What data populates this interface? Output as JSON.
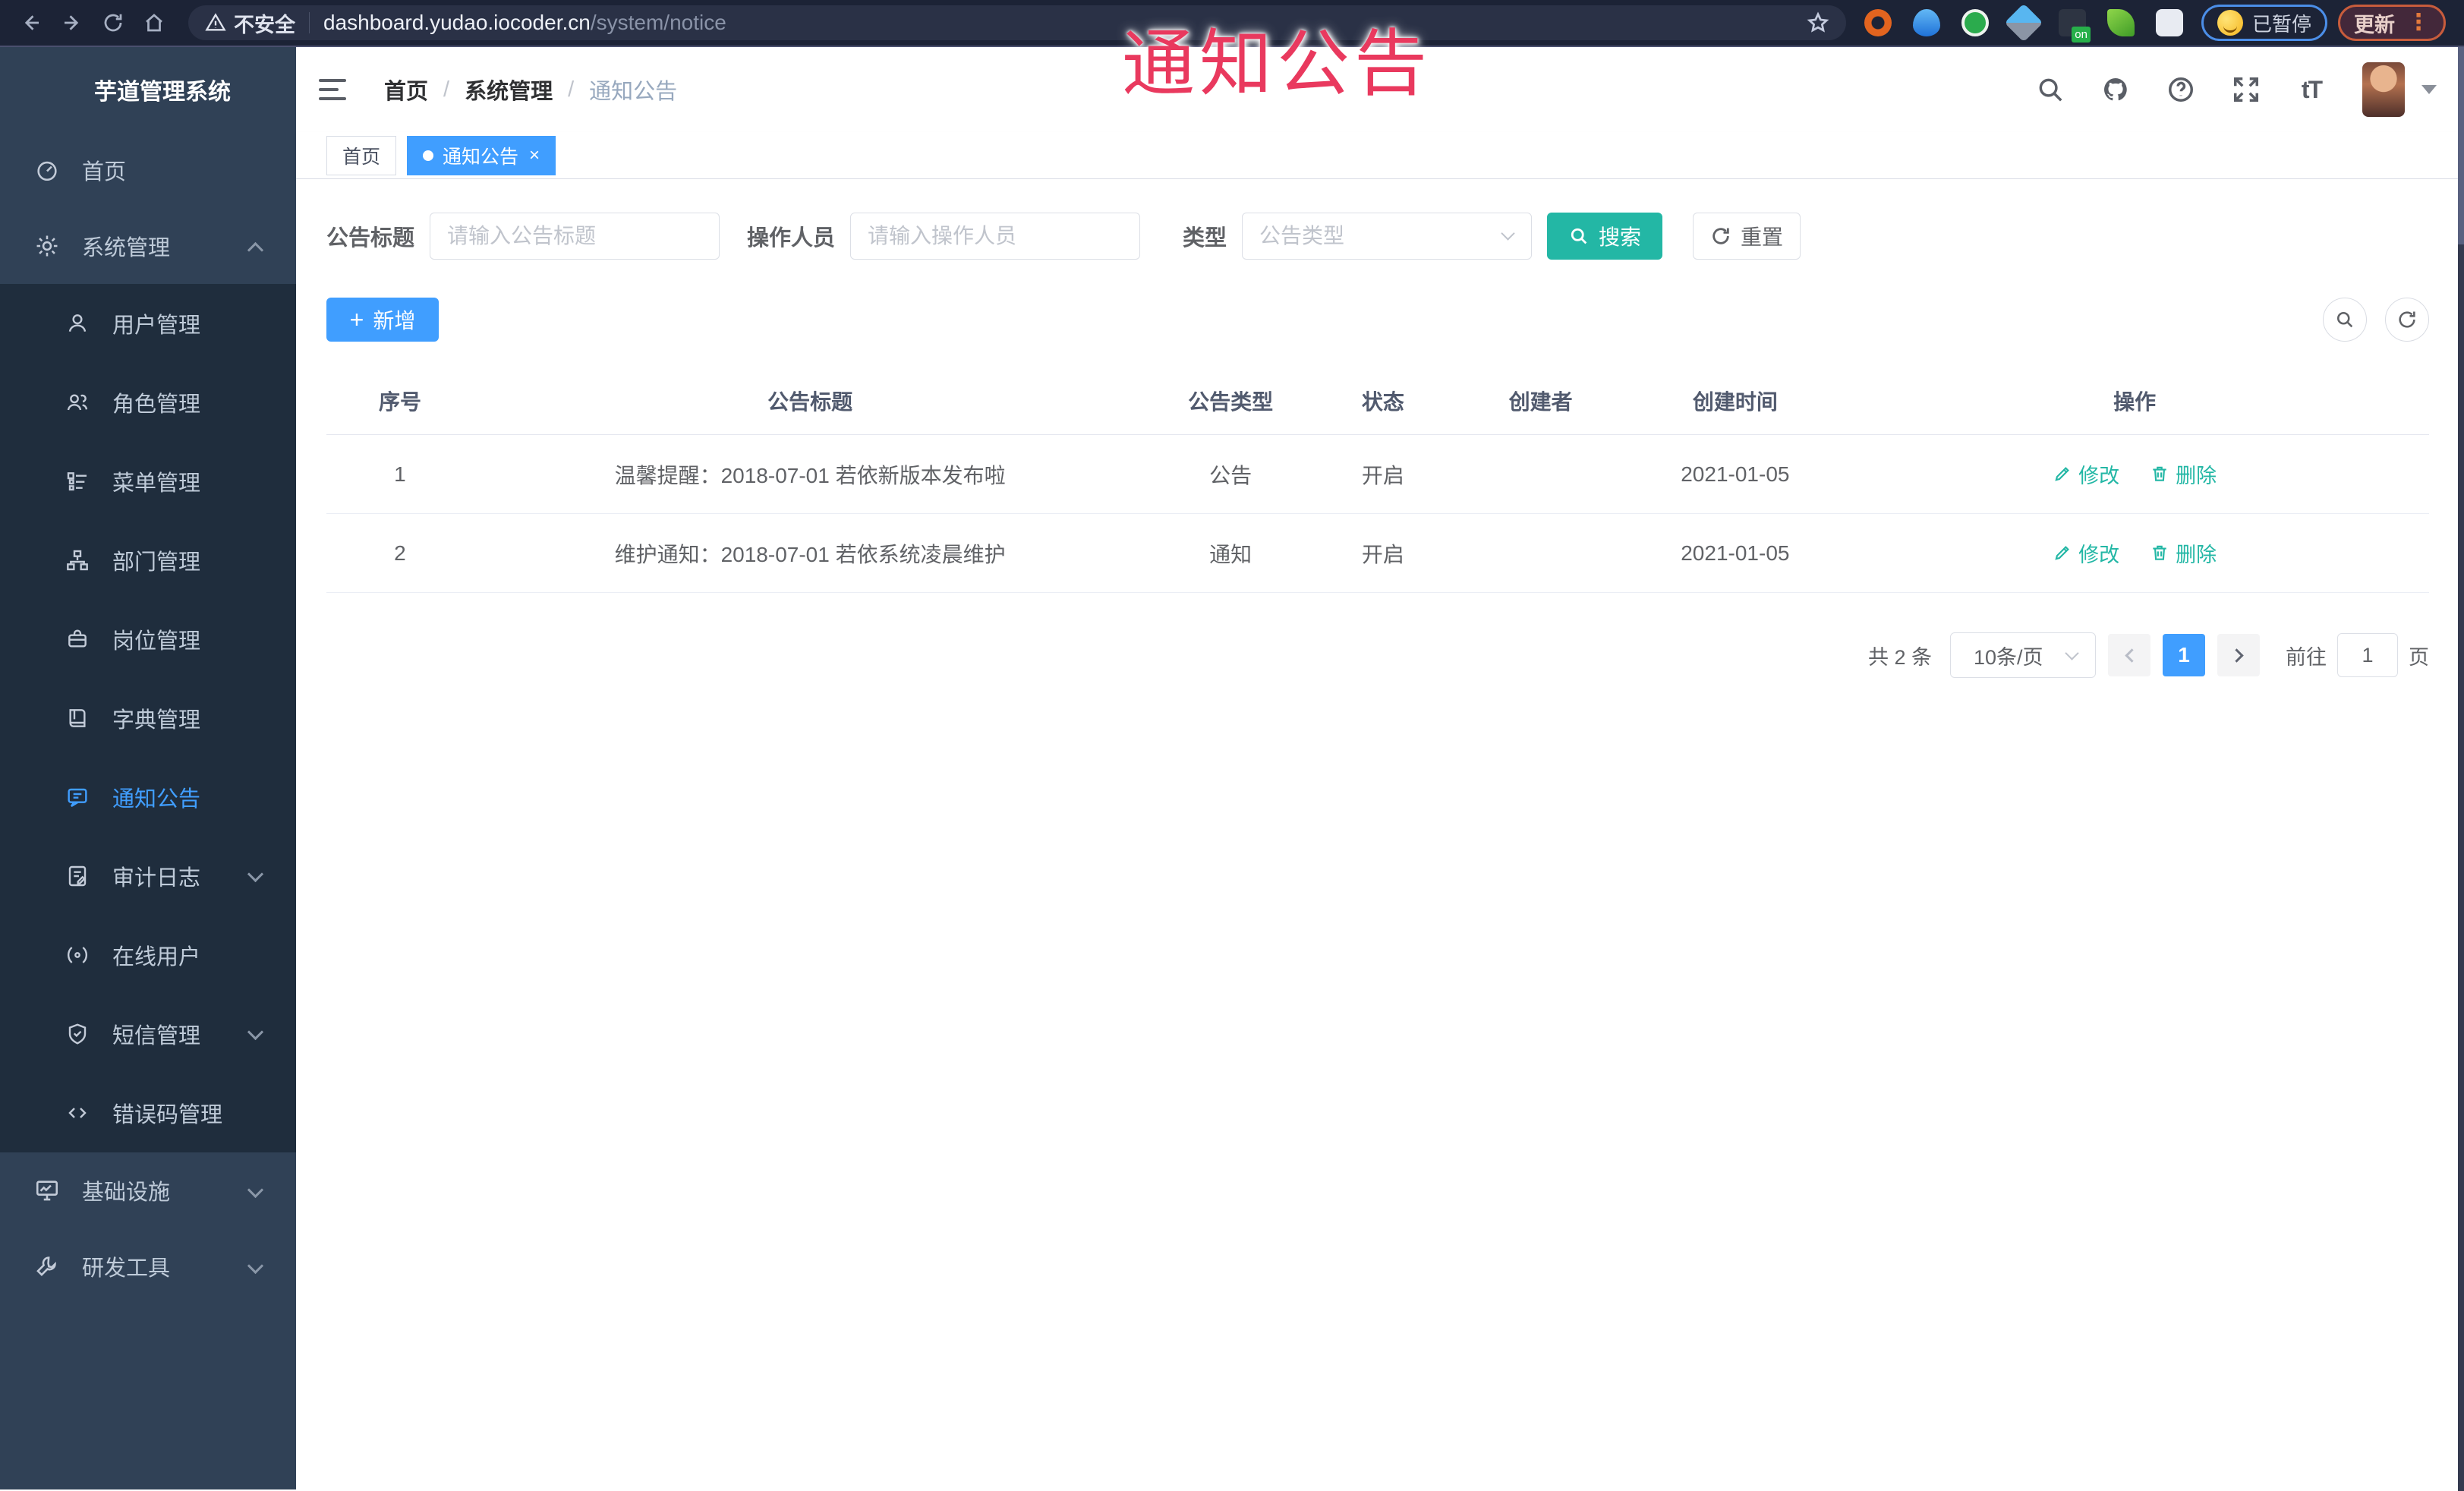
{
  "browser": {
    "security_warning": "不安全",
    "url_host": "dashboard.yudao.iocoder.cn",
    "url_path": "/system/notice",
    "paused_badge": "已暂停",
    "update_button": "更新",
    "icon_names": [
      "back-icon",
      "forward-icon",
      "reload-icon",
      "home-icon",
      "warning-icon",
      "bookmark-star-icon",
      "extension-ring-icon",
      "extension-drop-icon",
      "extension-green-icon",
      "extension-gem-icon",
      "extension-dark-on-icon",
      "extension-leaf-icon",
      "extensions-puzzle-icon",
      "profile-emoji-icon",
      "kebab-menu-icon"
    ]
  },
  "overlay": {
    "watermark_text": "通知公告",
    "watermark_color": "#e9395e"
  },
  "sidebar": {
    "logo_title": "芋道管理系统",
    "items": [
      {
        "label": "首页",
        "icon": "dashboard",
        "active": false
      },
      {
        "label": "系统管理",
        "icon": "gear",
        "arrow": "up",
        "children": [
          {
            "label": "用户管理",
            "icon": "user"
          },
          {
            "label": "角色管理",
            "icon": "peoples"
          },
          {
            "label": "菜单管理",
            "icon": "tree-table"
          },
          {
            "label": "部门管理",
            "icon": "tree"
          },
          {
            "label": "岗位管理",
            "icon": "post"
          },
          {
            "label": "字典管理",
            "icon": "dict"
          },
          {
            "label": "通知公告",
            "icon": "message",
            "active": true
          },
          {
            "label": "审计日志",
            "icon": "log",
            "arrow": "down"
          },
          {
            "label": "在线用户",
            "icon": "online"
          },
          {
            "label": "短信管理",
            "icon": "sms",
            "arrow": "down"
          },
          {
            "label": "错误码管理",
            "icon": "code"
          }
        ]
      },
      {
        "label": "基础设施",
        "icon": "monitor",
        "arrow": "down"
      },
      {
        "label": "研发工具",
        "icon": "tool",
        "arrow": "down"
      }
    ]
  },
  "header": {
    "breadcrumb": [
      "首页",
      "系统管理",
      "通知公告"
    ],
    "icon_names": [
      "search-icon",
      "github-icon",
      "help-icon",
      "fullscreen-icon",
      "font-size-icon",
      "avatar",
      "caret-down-icon"
    ]
  },
  "tabs": [
    {
      "label": "首页",
      "active": false,
      "closable": false
    },
    {
      "label": "通知公告",
      "active": true,
      "closable": true
    }
  ],
  "filters": {
    "title_label": "公告标题",
    "title_placeholder": "请输入公告标题",
    "operator_label": "操作人员",
    "operator_placeholder": "请输入操作人员",
    "type_label": "类型",
    "type_placeholder": "公告类型",
    "search_label": "搜索",
    "reset_label": "重置"
  },
  "toolbar": {
    "add_label": "新增"
  },
  "table": {
    "columns": [
      "序号",
      "公告标题",
      "公告类型",
      "状态",
      "创建者",
      "创建时间",
      "操作"
    ],
    "rows": [
      {
        "no": "1",
        "title": "温馨提醒：2018-07-01 若依新版本发布啦",
        "type": "公告",
        "status": "开启",
        "creator": "",
        "create_time": "2021-01-05"
      },
      {
        "no": "2",
        "title": "维护通知：2018-07-01 若依系统凌晨维护",
        "type": "通知",
        "status": "开启",
        "creator": "",
        "create_time": "2021-01-05"
      }
    ],
    "actions": {
      "edit": "修改",
      "delete": "删除"
    }
  },
  "pagination": {
    "total_text": "共 2 条",
    "page_size": "10条/页",
    "current_page": "1",
    "goto_label": "前往",
    "goto_value": "1",
    "page_unit": "页"
  },
  "colors": {
    "accent_blue": "#409eff",
    "teal": "#23b7a5",
    "sidebar_bg": "#304156",
    "submenu_bg": "#1f2d3d",
    "chrome_bg": "#1c2336",
    "watermark": "#e9395e"
  }
}
